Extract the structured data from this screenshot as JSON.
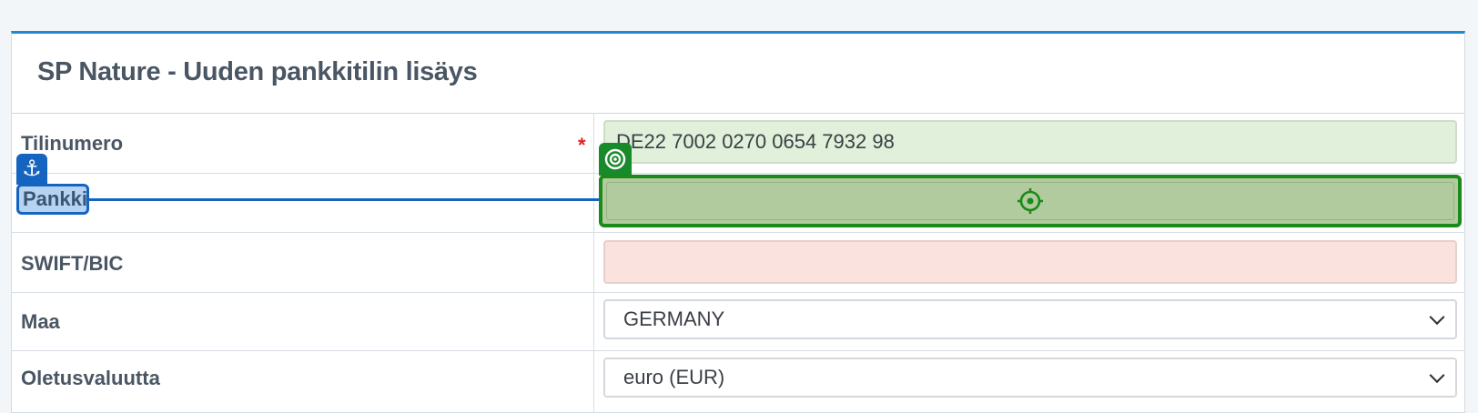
{
  "panel": {
    "title": "SP Nature - Uuden pankkitilin lisäys"
  },
  "form": {
    "rows": [
      {
        "label": "Tilinumero",
        "required_mark": "*",
        "value": "DE22 7002 0270 0654 7932 98"
      },
      {
        "label": "Pankki",
        "value": ""
      },
      {
        "label": "SWIFT/BIC",
        "value": ""
      },
      {
        "label": "Maa",
        "value": "GERMANY"
      },
      {
        "label": "Oletusvaluutta",
        "value": "euro (EUR)"
      }
    ]
  },
  "overlay": {
    "anchor_icon": "anchor-icon",
    "target_tag_icon": "concentric-target-icon",
    "target_icon": "crosshair-icon",
    "anchor_color": "#1565c0",
    "target_color": "#1a8a1a"
  }
}
